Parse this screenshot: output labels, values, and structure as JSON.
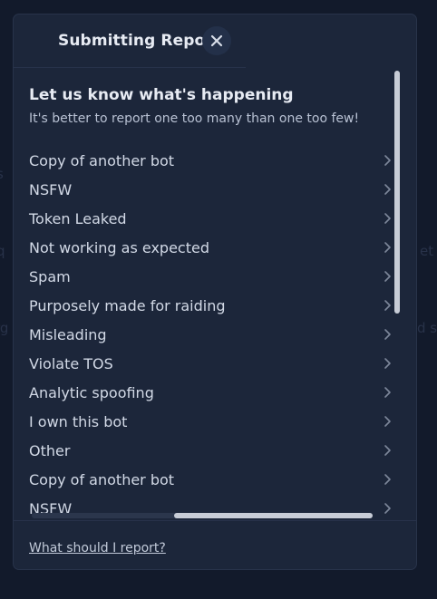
{
  "background_text": {
    "left_1": "s",
    "left_2": "q",
    "left_3": "rg",
    "right_1": "et",
    "right_2": "d s"
  },
  "modal": {
    "title": "Submitting Report",
    "close_icon": "close-icon",
    "heading": "Let us know what's happening",
    "subheading": "It's better to report one too many than one too few!",
    "reasons": [
      {
        "label": "Copy of another bot"
      },
      {
        "label": "NSFW"
      },
      {
        "label": "Token Leaked"
      },
      {
        "label": "Not working as expected"
      },
      {
        "label": "Spam"
      },
      {
        "label": "Purposely made for raiding"
      },
      {
        "label": "Misleading"
      },
      {
        "label": "Violate TOS"
      },
      {
        "label": "Analytic spoofing"
      },
      {
        "label": "I own this bot"
      },
      {
        "label": "Other"
      },
      {
        "label": "Copy of another bot"
      },
      {
        "label": "NSFW"
      }
    ],
    "footer_link": "What should I report?"
  },
  "colors": {
    "page_bg": "#121a2b",
    "modal_bg": "#1c263a",
    "text_primary": "#e7ebf3",
    "text_secondary": "#b8c1d3",
    "scroll_thumb": "#c7ccd6"
  }
}
